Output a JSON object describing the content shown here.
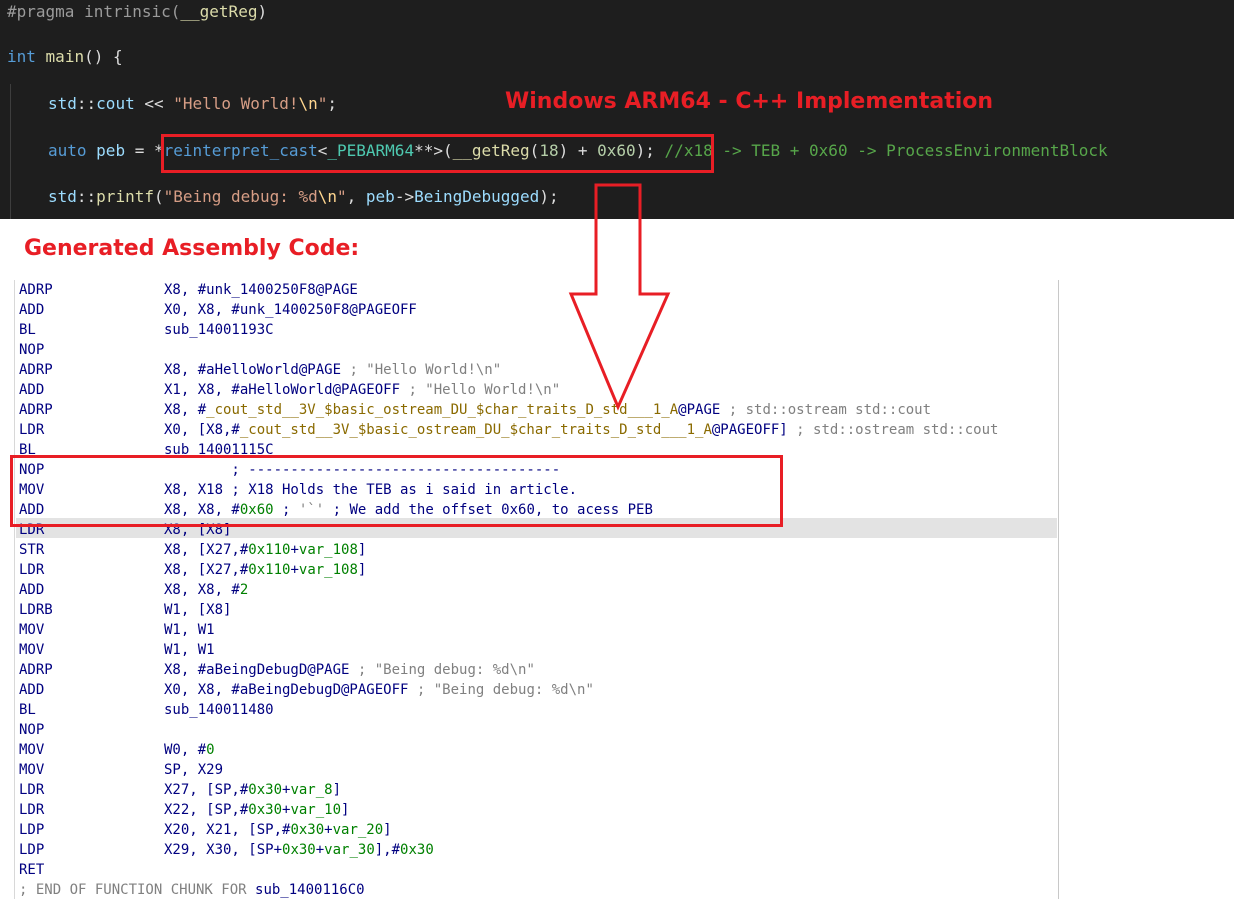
{
  "editor": {
    "lines": [
      {
        "tokens": [
          {
            "t": "#pragma intrinsic(",
            "c": "pp"
          },
          {
            "t": "__getReg",
            "c": "fn"
          },
          {
            "t": ")",
            "c": "op"
          }
        ]
      },
      {
        "tokens": [
          {
            "t": "int",
            "c": "k"
          },
          {
            "t": " ",
            "c": "op"
          },
          {
            "t": "main",
            "c": "fn"
          },
          {
            "t": "() {",
            "c": "op"
          }
        ]
      },
      {
        "tokens": [
          {
            "t": "std",
            "c": "v"
          },
          {
            "t": "::",
            "c": "op"
          },
          {
            "t": "cout",
            "c": "v"
          },
          {
            "t": " << ",
            "c": "op"
          },
          {
            "t": "\"Hello World!",
            "c": "s"
          },
          {
            "t": "\\n",
            "c": "esc"
          },
          {
            "t": "\"",
            "c": "s"
          },
          {
            "t": ";",
            "c": "op"
          }
        ]
      },
      {
        "tokens": [
          {
            "t": "auto",
            "c": "k"
          },
          {
            "t": " ",
            "c": "op"
          },
          {
            "t": "peb",
            "c": "v"
          },
          {
            "t": " = *",
            "c": "op"
          },
          {
            "t": "reinterpret_cast",
            "c": "k"
          },
          {
            "t": "<",
            "c": "op"
          },
          {
            "t": "_PEBARM64",
            "c": "ty"
          },
          {
            "t": "**>(",
            "c": "op"
          },
          {
            "t": "__getReg",
            "c": "fn"
          },
          {
            "t": "(",
            "c": "op"
          },
          {
            "t": "18",
            "c": "n"
          },
          {
            "t": ") + ",
            "c": "op"
          },
          {
            "t": "0x60",
            "c": "n"
          },
          {
            "t": "); ",
            "c": "op"
          },
          {
            "t": "//x18 -> TEB + 0x60 -> ProcessEnvironmentBlock",
            "c": "cm"
          }
        ]
      },
      {
        "tokens": [
          {
            "t": "std",
            "c": "v"
          },
          {
            "t": "::",
            "c": "op"
          },
          {
            "t": "printf",
            "c": "fn"
          },
          {
            "t": "(",
            "c": "op"
          },
          {
            "t": "\"Being debug: %d",
            "c": "s"
          },
          {
            "t": "\\n",
            "c": "esc"
          },
          {
            "t": "\"",
            "c": "s"
          },
          {
            "t": ", ",
            "c": "op"
          },
          {
            "t": "peb",
            "c": "v"
          },
          {
            "t": "->",
            "c": "op"
          },
          {
            "t": "BeingDebugged",
            "c": "v"
          },
          {
            "t": ");",
            "c": "op"
          }
        ]
      }
    ]
  },
  "titles": {
    "main": "Windows ARM64 - C++ Implementation",
    "assembly": "Generated Assembly Code:"
  },
  "assembly": {
    "rows": [
      {
        "m": "ADRP",
        "o": [
          {
            "t": "X8, #unk_1400250F8@PAGE",
            "c": "a-e"
          }
        ]
      },
      {
        "m": "ADD",
        "o": [
          {
            "t": "X0, X8, #unk_1400250F8@PAGEOFF",
            "c": "a-e"
          }
        ]
      },
      {
        "m": "BL",
        "o": [
          {
            "t": "sub_14001193C",
            "c": "a-e"
          }
        ]
      },
      {
        "m": "NOP",
        "o": []
      },
      {
        "m": "ADRP",
        "o": [
          {
            "t": "X8, #aHelloWorld@PAGE ",
            "c": "a-e"
          },
          {
            "t": "; \"Hello World!\\n\"",
            "c": "a-c"
          }
        ]
      },
      {
        "m": "ADD",
        "o": [
          {
            "t": "X1, X8, #aHelloWorld@PAGEOFF ",
            "c": "a-e"
          },
          {
            "t": "; \"Hello World!\\n\"",
            "c": "a-c"
          }
        ]
      },
      {
        "m": "ADRP",
        "o": [
          {
            "t": "X8, #",
            "c": "a-e"
          },
          {
            "t": "_cout_std__3V_$basic_ostream_DU_$char_traits_D_std___1_A",
            "c": "a-l"
          },
          {
            "t": "@PAGE ",
            "c": "a-e"
          },
          {
            "t": "; std::ostream std::cout",
            "c": "a-c"
          }
        ]
      },
      {
        "m": "LDR",
        "o": [
          {
            "t": "X0, [X8,#",
            "c": "a-e"
          },
          {
            "t": "_cout_std__3V_$basic_ostream_DU_$char_traits_D_std___1_A",
            "c": "a-l"
          },
          {
            "t": "@PAGEOFF] ",
            "c": "a-e"
          },
          {
            "t": "; std::ostream std::cout",
            "c": "a-c"
          }
        ]
      },
      {
        "m": "BL",
        "o": [
          {
            "t": "sub_14001115C",
            "c": "a-e"
          }
        ]
      },
      {
        "m": "NOP",
        "o": [
          {
            "t": "        ; -------------------------------------",
            "c": "a-e"
          }
        ]
      },
      {
        "m": "MOV",
        "o": [
          {
            "t": "X8, X18 ; X18 Holds the TEB as i said in article.",
            "c": "a-e"
          }
        ]
      },
      {
        "m": "ADD",
        "o": [
          {
            "t": "X8, X8, #",
            "c": "a-e"
          },
          {
            "t": "0x60",
            "c": "a-n"
          },
          {
            "t": " ; ",
            "c": "a-e"
          },
          {
            "t": "'`'",
            "c": "a-c"
          },
          {
            "t": " ; We add the offset 0x60, to acess PEB",
            "c": "a-e"
          }
        ]
      },
      {
        "m": "LDR",
        "o": [
          {
            "t": "X8, [X8]",
            "c": "a-e"
          }
        ]
      },
      {
        "m": "STR",
        "o": [
          {
            "t": "X8, [X27,#",
            "c": "a-e"
          },
          {
            "t": "0x110",
            "c": "a-n"
          },
          {
            "t": "+",
            "c": "a-e"
          },
          {
            "t": "var_108",
            "c": "a-v"
          },
          {
            "t": "]",
            "c": "a-e"
          }
        ]
      },
      {
        "m": "LDR",
        "o": [
          {
            "t": "X8, [X27,#",
            "c": "a-e"
          },
          {
            "t": "0x110",
            "c": "a-n"
          },
          {
            "t": "+",
            "c": "a-e"
          },
          {
            "t": "var_108",
            "c": "a-v"
          },
          {
            "t": "]",
            "c": "a-e"
          }
        ]
      },
      {
        "m": "ADD",
        "o": [
          {
            "t": "X8, X8, #",
            "c": "a-e"
          },
          {
            "t": "2",
            "c": "a-n"
          }
        ]
      },
      {
        "m": "LDRB",
        "o": [
          {
            "t": "W1, [X8]",
            "c": "a-e"
          }
        ]
      },
      {
        "m": "MOV",
        "o": [
          {
            "t": "W1, W1",
            "c": "a-e"
          }
        ]
      },
      {
        "m": "MOV",
        "o": [
          {
            "t": "W1, W1",
            "c": "a-e"
          }
        ]
      },
      {
        "m": "ADRP",
        "o": [
          {
            "t": "X8, #aBeingDebugD@PAGE ",
            "c": "a-e"
          },
          {
            "t": "; \"Being debug: %d\\n\"",
            "c": "a-c"
          }
        ]
      },
      {
        "m": "ADD",
        "o": [
          {
            "t": "X0, X8, #aBeingDebugD@PAGEOFF ",
            "c": "a-e"
          },
          {
            "t": "; \"Being debug: %d\\n\"",
            "c": "a-c"
          }
        ]
      },
      {
        "m": "BL",
        "o": [
          {
            "t": "sub_140011480",
            "c": "a-e"
          }
        ]
      },
      {
        "m": "NOP",
        "o": []
      },
      {
        "m": "MOV",
        "o": [
          {
            "t": "W0, #",
            "c": "a-e"
          },
          {
            "t": "0",
            "c": "a-n"
          }
        ]
      },
      {
        "m": "MOV",
        "o": [
          {
            "t": "SP, X29",
            "c": "a-e"
          }
        ]
      },
      {
        "m": "LDR",
        "o": [
          {
            "t": "X27, [SP,#",
            "c": "a-e"
          },
          {
            "t": "0x30",
            "c": "a-n"
          },
          {
            "t": "+",
            "c": "a-e"
          },
          {
            "t": "var_8",
            "c": "a-v"
          },
          {
            "t": "]",
            "c": "a-e"
          }
        ]
      },
      {
        "m": "LDR",
        "o": [
          {
            "t": "X22, [SP,#",
            "c": "a-e"
          },
          {
            "t": "0x30",
            "c": "a-n"
          },
          {
            "t": "+",
            "c": "a-e"
          },
          {
            "t": "var_10",
            "c": "a-v"
          },
          {
            "t": "]",
            "c": "a-e"
          }
        ]
      },
      {
        "m": "LDP",
        "o": [
          {
            "t": "X20, X21, [SP,#",
            "c": "a-e"
          },
          {
            "t": "0x30",
            "c": "a-n"
          },
          {
            "t": "+",
            "c": "a-e"
          },
          {
            "t": "var_20",
            "c": "a-v"
          },
          {
            "t": "]",
            "c": "a-e"
          }
        ]
      },
      {
        "m": "LDP",
        "o": [
          {
            "t": "X29, X30, [SP+",
            "c": "a-e"
          },
          {
            "t": "0x30",
            "c": "a-n"
          },
          {
            "t": "+",
            "c": "a-e"
          },
          {
            "t": "var_30",
            "c": "a-v"
          },
          {
            "t": "],#",
            "c": "a-e"
          },
          {
            "t": "0x30",
            "c": "a-n"
          }
        ]
      },
      {
        "m": "RET",
        "o": []
      },
      {
        "m": "",
        "o": [
          {
            "t": "; END OF FUNCTION CHUNK FOR ",
            "c": "a-c"
          },
          {
            "t": "sub_1400116C0",
            "c": "a-e"
          }
        ]
      }
    ]
  }
}
